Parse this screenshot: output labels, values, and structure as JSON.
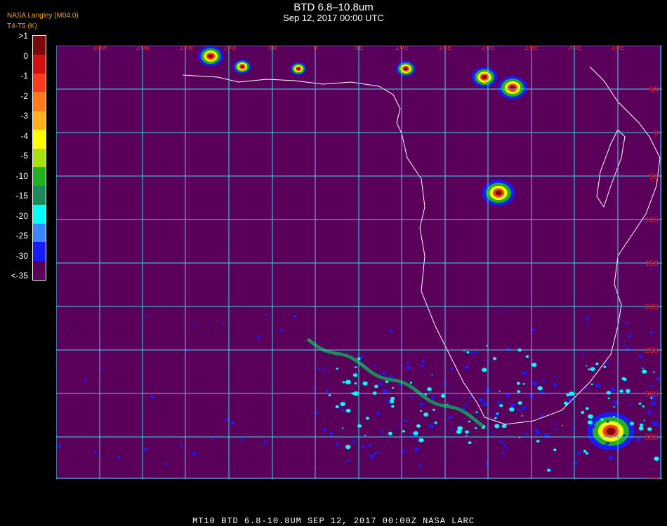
{
  "header": {
    "title": "BTD 6.8–10.8um",
    "subtitle": "Sep 12, 2017 00:00 UTC",
    "source_line1": "NASA Langley (M04.0)",
    "source_line2": "T4-T5 (K)"
  },
  "legend": {
    "labels": [
      ">1",
      "0",
      "-1",
      "-2",
      "-3",
      "-4",
      "-5",
      "-10",
      "-15",
      "-20",
      "-25",
      "-30",
      "<-35"
    ],
    "colors": [
      "#7a0a0a",
      "#d41010",
      "#ff3a1a",
      "#ff7a1a",
      "#ffb01a",
      "#ffff00",
      "#a8e010",
      "#20b020",
      "#1a8a5a",
      "#00ffff",
      "#3a88ff",
      "#1a1aff",
      "#5a005a"
    ]
  },
  "map": {
    "lon_labels": [
      "25W",
      "20W",
      "15W",
      "10W",
      "5W",
      "0",
      "5E",
      "10E",
      "15E",
      "20E",
      "25E",
      "30E",
      "35E"
    ],
    "lat_labels": [
      "5N",
      "0",
      "5S",
      "10S",
      "15S",
      "20S",
      "25S",
      "30S",
      "35S",
      "40S"
    ],
    "background": "#5a005a",
    "grid_color": "#40d8e8",
    "label_color": "#e02020"
  },
  "footer": {
    "text": "MT10  BTD 6.8-10.8UM    SEP 12, 2017 00:00Z    NASA LARC"
  }
}
